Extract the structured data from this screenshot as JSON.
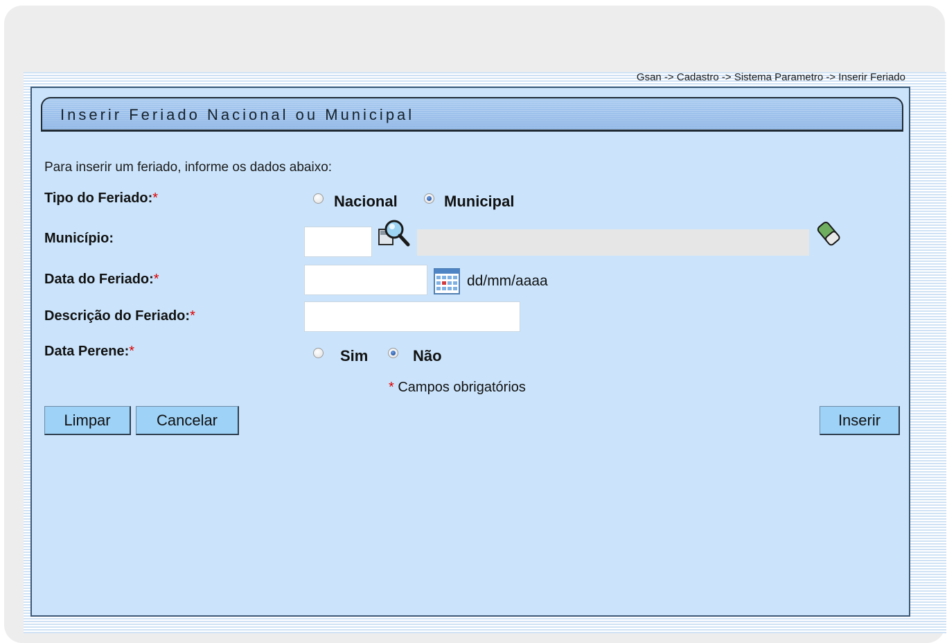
{
  "breadcrumb": "Gsan -> Cadastro -> Sistema Parametro -> Inserir Feriado",
  "panel_title": "Inserir Feriado Nacional ou Municipal",
  "intro": "Para inserir um feriado, informe os dados abaixo:",
  "fields": {
    "tipo": {
      "label": "Tipo do Feriado:",
      "required_mark": "*",
      "options": [
        {
          "label": "Nacional",
          "checked": false
        },
        {
          "label": "Municipal",
          "checked": true
        }
      ]
    },
    "municipio": {
      "label": "Município:",
      "code_value": "",
      "name_value": "",
      "search_icon": "magnifier-search-icon",
      "clear_icon": "eraser-icon"
    },
    "data": {
      "label": "Data do Feriado:",
      "required_mark": "*",
      "value": "",
      "calendar_icon": "calendar-icon",
      "format_hint": "dd/mm/aaaa"
    },
    "descricao": {
      "label": "Descrição do Feriado:",
      "required_mark": "*",
      "value": ""
    },
    "perene": {
      "label": "Data Perene:",
      "required_mark": "*",
      "options": [
        {
          "label": "Sim",
          "checked": false
        },
        {
          "label": "Não",
          "checked": true
        }
      ]
    }
  },
  "required_note": {
    "mark": "*",
    "text": " Campos obrigatórios"
  },
  "buttons": {
    "limpar": "Limpar",
    "cancelar": "Cancelar",
    "inserir": "Inserir"
  },
  "colors": {
    "panel_bg": "#cbe4fb",
    "title_bar": "#9cc1ec",
    "button_bg": "#9ed2f7",
    "required": "#e00000"
  }
}
